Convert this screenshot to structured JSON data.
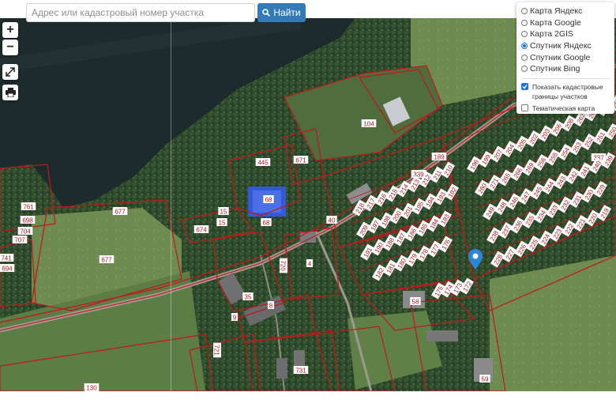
{
  "search": {
    "placeholder": "Адрес или кадастровый номер участка",
    "button_label": "Найти"
  },
  "zoom": {
    "in_label": "+",
    "out_label": "−"
  },
  "layers": {
    "items": [
      {
        "label": "Карта Яндекс",
        "selected": false
      },
      {
        "label": "Карта Google",
        "selected": false
      },
      {
        "label": "Карта 2GIS",
        "selected": false
      },
      {
        "label": "Спутник Яндекс",
        "selected": true
      },
      {
        "label": "Спутник Google",
        "selected": false
      },
      {
        "label": "Спутник Bing",
        "selected": false
      }
    ],
    "cadastral_label_1": "Показать кадастровые",
    "cadastral_label_2": "границы участков",
    "cadastral_checked": true,
    "thematic_label": "Тематическая карта",
    "thematic_checked": false
  },
  "parcel_labels": [
    "104",
    "445",
    "671",
    "68",
    "68",
    "677",
    "677",
    "674",
    "15",
    "15",
    "40",
    "4",
    "8",
    "9",
    "35",
    "58",
    "59",
    "130",
    "731",
    "720",
    "721",
    "761",
    "698",
    "704",
    "707",
    "741",
    "694",
    "337",
    "339",
    "189",
    "196",
    "199",
    "207",
    "204",
    "205",
    "202",
    "203",
    "206",
    "208",
    "262",
    "263",
    "259",
    "258",
    "260",
    "271",
    "265",
    "266",
    "269",
    "256",
    "255",
    "254",
    "253",
    "252",
    "251",
    "250",
    "249",
    "248",
    "246",
    "247",
    "245",
    "244",
    "243",
    "242",
    "241",
    "240",
    "239",
    "238",
    "237",
    "236",
    "235",
    "234",
    "233",
    "232",
    "231",
    "230",
    "229",
    "228",
    "227",
    "226",
    "225",
    "224",
    "223",
    "222",
    "221",
    "220",
    "219",
    "218",
    "217",
    "216",
    "215",
    "214",
    "213",
    "212",
    "211",
    "210",
    "209",
    "197",
    "198",
    "200",
    "201",
    "195",
    "194",
    "193",
    "192",
    "191",
    "190",
    "188",
    "187",
    "186",
    "185",
    "184",
    "183",
    "182",
    "181",
    "180",
    "179",
    "178",
    "177",
    "176",
    "175",
    "174",
    "173",
    "172",
    "171",
    "170",
    "169",
    "168",
    "167",
    "166",
    "165",
    "164",
    "163",
    "162",
    "161",
    "160",
    "159",
    "158",
    "157",
    "156",
    "155",
    "154",
    "153",
    "152",
    "151",
    "150"
  ],
  "colors": {
    "river": "#1f2d2e",
    "forest_dark": "#2f4a2a",
    "field": "#6f8f4e",
    "parcel_line": "#c4161c",
    "label_bg": "#ffffff",
    "label_text": "#b3141a",
    "marker": "#2a86d8",
    "accent": "#337ab7"
  },
  "icons": {
    "search_button": "magnifier-icon",
    "fullscreen": "expand-arrows-icon",
    "print": "printer-icon",
    "location_marker": "map-pin-icon"
  }
}
